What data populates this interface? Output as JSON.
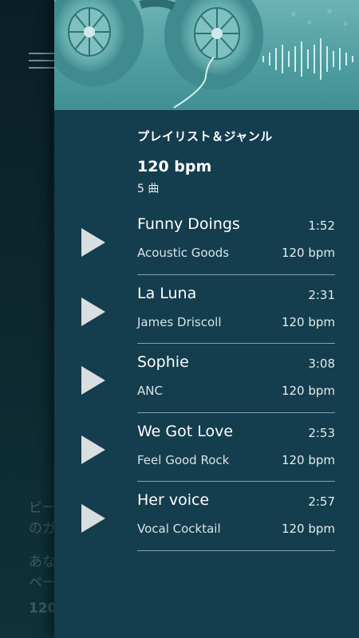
{
  "background": {
    "text_lines": [
      "ビー",
      "のガ",
      "あな",
      "ペー",
      "120"
    ]
  },
  "drawer": {
    "section_title": "プレイリスト＆ジャンル",
    "playlist": {
      "name": "120 bpm",
      "count": "5 曲"
    },
    "tracks": [
      {
        "title": "Funny Doings",
        "artist": "Acoustic Goods",
        "duration": "1:52",
        "bpm": "120 bpm"
      },
      {
        "title": "La Luna",
        "artist": "James Driscoll",
        "duration": "2:31",
        "bpm": "120 bpm"
      },
      {
        "title": "Sophie",
        "artist": "ANC",
        "duration": "3:08",
        "bpm": "120 bpm"
      },
      {
        "title": "We Got Love",
        "artist": "Feel Good Rock",
        "duration": "2:53",
        "bpm": "120 bpm"
      },
      {
        "title": "Her voice",
        "artist": "Vocal Cocktail",
        "duration": "2:57",
        "bpm": "120 bpm"
      }
    ]
  },
  "icons": {
    "menu": "hamburger-menu-icon",
    "play": "play-icon",
    "header": "headphones-image"
  },
  "colors": {
    "drawer_bg": "#143d4d",
    "header_tint": "#4f9ea1",
    "play_icon": "#d9dede",
    "divider": "#8aa3aa"
  }
}
